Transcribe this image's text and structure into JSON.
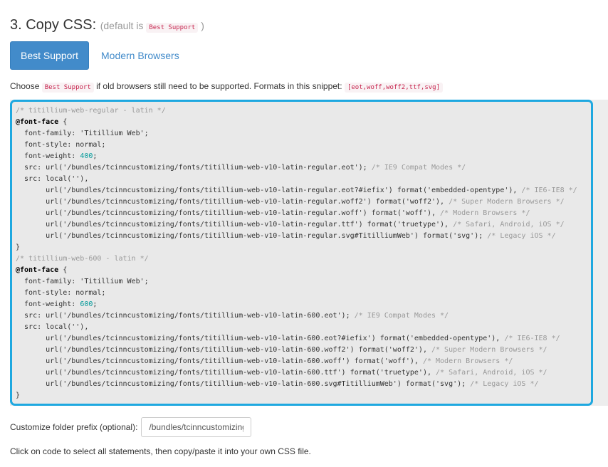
{
  "section": {
    "title": "3. Copy CSS:",
    "default_prefix": "(default is",
    "default_value": "Best Support",
    "default_suffix": ")"
  },
  "tabs": {
    "best_support": "Best Support",
    "modern_browsers": "Modern Browsers"
  },
  "intro": {
    "choose": "Choose",
    "code": "Best Support",
    "text": "if old browsers still need to be supported. Formats in this snippet:",
    "formats": "[eot,woff,woff2,ttf,svg]"
  },
  "code": {
    "lines": [
      {
        "t": "c",
        "v": "/* titillium-web-regular - latin */"
      },
      {
        "t": "k",
        "v": "@font-face",
        "s": " {"
      },
      {
        "t": "p",
        "v": "  font-family: 'Titillium Web';"
      },
      {
        "t": "p",
        "v": "  font-style: normal;"
      },
      {
        "t": "n",
        "v": "  font-weight: ",
        "n": "400",
        "s": ";"
      },
      {
        "t": "m",
        "v": "  src: url('/bundles/tcinncustomizing/fonts/titillium-web-v10-latin-regular.eot'); ",
        "c": "/* IE9 Compat Modes */"
      },
      {
        "t": "p",
        "v": "  src: local(''),"
      },
      {
        "t": "m",
        "v": "       url('/bundles/tcinncustomizing/fonts/titillium-web-v10-latin-regular.eot?#iefix') format('embedded-opentype'), ",
        "c": "/* IE6-IE8 */"
      },
      {
        "t": "m",
        "v": "       url('/bundles/tcinncustomizing/fonts/titillium-web-v10-latin-regular.woff2') format('woff2'), ",
        "c": "/* Super Modern Browsers */"
      },
      {
        "t": "m",
        "v": "       url('/bundles/tcinncustomizing/fonts/titillium-web-v10-latin-regular.woff') format('woff'), ",
        "c": "/* Modern Browsers */"
      },
      {
        "t": "m",
        "v": "       url('/bundles/tcinncustomizing/fonts/titillium-web-v10-latin-regular.ttf') format('truetype'), ",
        "c": "/* Safari, Android, iOS */"
      },
      {
        "t": "m",
        "v": "       url('/bundles/tcinncustomizing/fonts/titillium-web-v10-latin-regular.svg#TitilliumWeb') format('svg'); ",
        "c": "/* Legacy iOS */"
      },
      {
        "t": "p",
        "v": "}"
      },
      {
        "t": "c",
        "v": "/* titillium-web-600 - latin */"
      },
      {
        "t": "k",
        "v": "@font-face",
        "s": " {"
      },
      {
        "t": "p",
        "v": "  font-family: 'Titillium Web';"
      },
      {
        "t": "p",
        "v": "  font-style: normal;"
      },
      {
        "t": "n",
        "v": "  font-weight: ",
        "n": "600",
        "s": ";"
      },
      {
        "t": "m",
        "v": "  src: url('/bundles/tcinncustomizing/fonts/titillium-web-v10-latin-600.eot'); ",
        "c": "/* IE9 Compat Modes */"
      },
      {
        "t": "p",
        "v": "  src: local(''),"
      },
      {
        "t": "m",
        "v": "       url('/bundles/tcinncustomizing/fonts/titillium-web-v10-latin-600.eot?#iefix') format('embedded-opentype'), ",
        "c": "/* IE6-IE8 */"
      },
      {
        "t": "m",
        "v": "       url('/bundles/tcinncustomizing/fonts/titillium-web-v10-latin-600.woff2') format('woff2'), ",
        "c": "/* Super Modern Browsers */"
      },
      {
        "t": "m",
        "v": "       url('/bundles/tcinncustomizing/fonts/titillium-web-v10-latin-600.woff') format('woff'), ",
        "c": "/* Modern Browsers */"
      },
      {
        "t": "m",
        "v": "       url('/bundles/tcinncustomizing/fonts/titillium-web-v10-latin-600.ttf') format('truetype'), ",
        "c": "/* Safari, Android, iOS */"
      },
      {
        "t": "m",
        "v": "       url('/bundles/tcinncustomizing/fonts/titillium-web-v10-latin-600.svg#TitilliumWeb') format('svg'); ",
        "c": "/* Legacy iOS */"
      },
      {
        "t": "p",
        "v": "}"
      }
    ]
  },
  "prefix": {
    "label": "Customize folder prefix (optional):",
    "value": "/bundles/tcinncustomizing/fonts/"
  },
  "footer": {
    "note": "Click on code to select all statements, then copy/paste it into your own CSS file."
  },
  "colors": {
    "accent": "#428bca",
    "highlight_border": "#1ea8e0",
    "code_background": "#e9e9e9"
  }
}
